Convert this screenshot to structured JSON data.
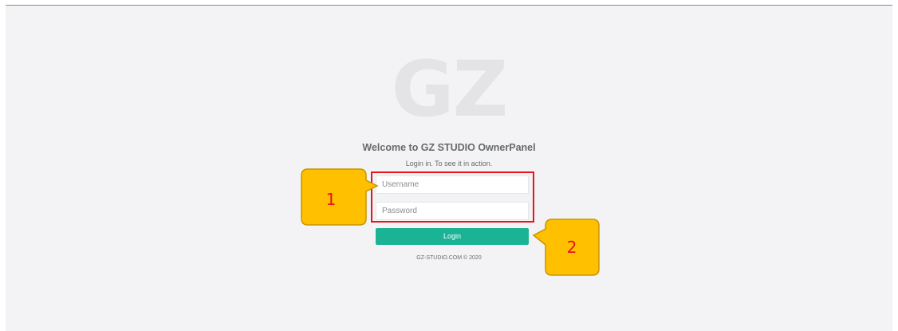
{
  "brand": {
    "logo_text": "GZ"
  },
  "login": {
    "title": "Welcome to GZ STUDIO OwnerPanel",
    "subtitle": "Login in. To see it in action.",
    "username_placeholder": "Username",
    "password_placeholder": "Password",
    "login_label": "Login"
  },
  "footer": {
    "text": "GZ-STUDIO.COM © 2020"
  },
  "annotations": {
    "callout_1": "1",
    "callout_2": "2"
  },
  "colors": {
    "accent": "#1ab394",
    "callout_fill": "#ffc000",
    "callout_border": "#c89500",
    "highlight": "#e8131b",
    "background": "#f3f3f5"
  }
}
